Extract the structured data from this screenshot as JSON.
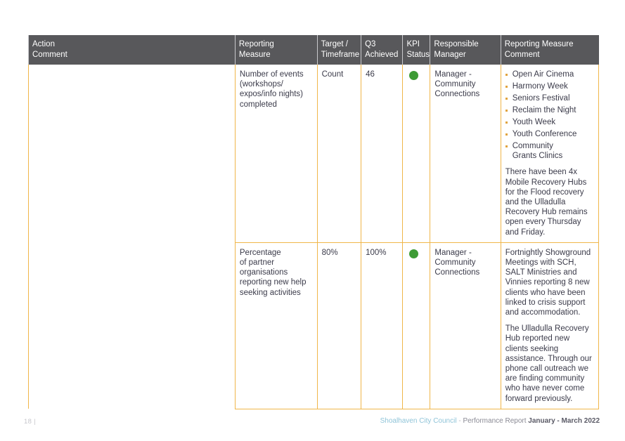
{
  "document": {
    "page_number": "18",
    "page_number_separator": "|"
  },
  "table": {
    "columns": [
      {
        "key": "action",
        "label": "Action\nComment"
      },
      {
        "key": "measure",
        "label": "Reporting\nMeasure"
      },
      {
        "key": "target",
        "label": "Target /\nTimeframe"
      },
      {
        "key": "achieved",
        "label": "Q3\nAchieved"
      },
      {
        "key": "kpi",
        "label": "KPI\nStatus"
      },
      {
        "key": "manager",
        "label": "Responsible\nManager"
      },
      {
        "key": "comment",
        "label": "Reporting Measure\nComment"
      }
    ],
    "rows": [
      {
        "action": "",
        "measure": "Number of events\n(workshops/\nexpos/info nights)\ncompleted",
        "target": "Count",
        "achieved": "46",
        "kpi_status": "green",
        "kpi_color": "#3d9b35",
        "manager": "Manager -\nCommunity\nConnections",
        "comment_bullets": [
          "Open Air Cinema",
          "Harmony Week",
          "Seniors Festival",
          "Reclaim the Night",
          "Youth Week",
          "Youth Conference",
          "Community\nGrants Clinics"
        ],
        "comment_paragraphs": [
          "There have been 4x Mobile Recovery Hubs for the Flood recovery and the Ulladulla Recovery Hub remains open every Thursday and Friday."
        ]
      },
      {
        "action": "",
        "measure": "Percentage\nof partner\norganisations\nreporting new help\nseeking activities",
        "target": "80%",
        "achieved": "100%",
        "kpi_status": "green",
        "kpi_color": "#3d9b35",
        "manager": "Manager -\nCommunity\nConnections",
        "comment_bullets": [],
        "comment_paragraphs": [
          "Fortnightly Showground Meetings with SCH, SALT Ministries and Vinnies reporting 8 new clients who have been linked to crisis support and accommodation.",
          "The Ulladulla Recovery Hub reported new clients seeking assistance. Through our phone call outreach we are finding community who have never come forward previously."
        ]
      }
    ]
  },
  "footer": {
    "council": "Shoalhaven City Council",
    "separator": "-",
    "report_label": "Performance Report",
    "period": "January - March 2022"
  },
  "colors": {
    "header_bg": "#58585b",
    "grid": "#f0b64a",
    "status_green": "#3d9b35",
    "council_blue": "#8fc4d8",
    "text": "#3b3b4a"
  }
}
